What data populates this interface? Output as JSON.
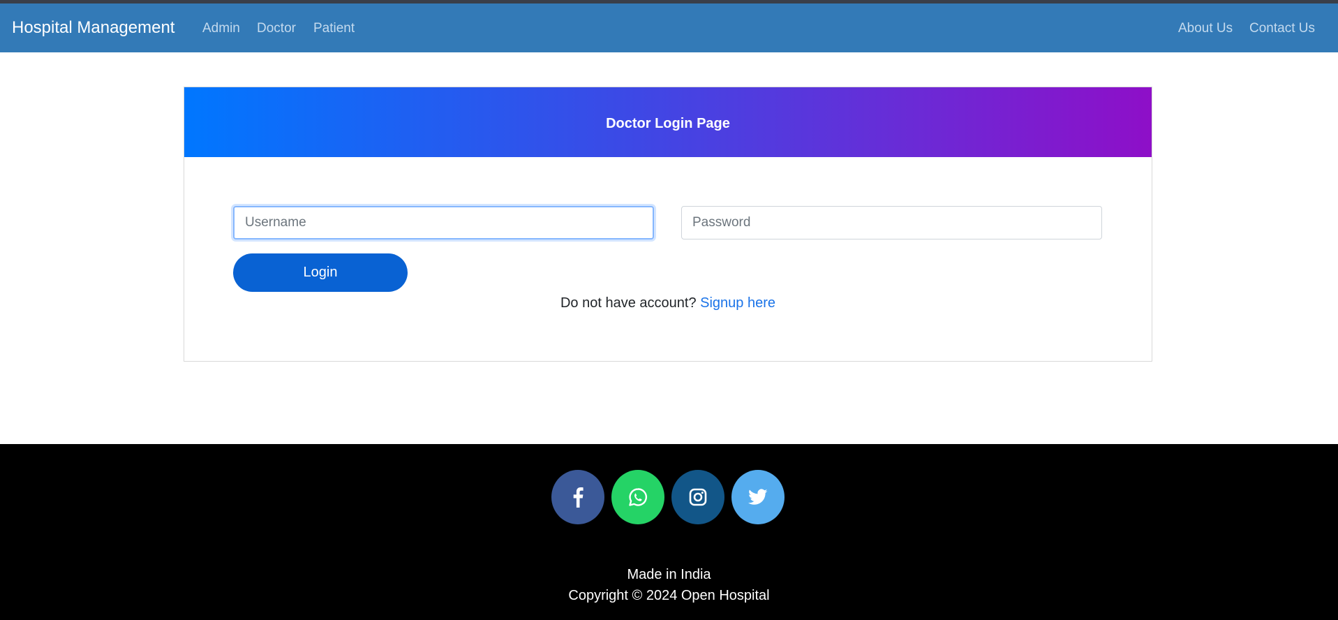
{
  "navbar": {
    "brand": "Hospital Management",
    "links": [
      "Admin",
      "Doctor",
      "Patient"
    ],
    "right_links": [
      "About Us",
      "Contact Us"
    ]
  },
  "card": {
    "title": "Doctor Login Page",
    "username_placeholder": "Username",
    "username_value": "",
    "password_placeholder": "Password",
    "password_value": "",
    "login_label": "Login",
    "signup_prompt": "Do not have account?",
    "signup_link": "Signup here"
  },
  "footer": {
    "social": [
      {
        "name": "facebook-icon",
        "color": "#3b5998"
      },
      {
        "name": "whatsapp-icon",
        "color": "#25d366"
      },
      {
        "name": "instagram-icon",
        "color": "#125688"
      },
      {
        "name": "twitter-icon",
        "color": "#55acee"
      }
    ],
    "made_in": "Made in India",
    "copyright": "Copyright © 2024 Open Hospital"
  },
  "colors": {
    "navbar": "#337ab7",
    "login_button": "#0962d3",
    "link": "#1a73e8",
    "footer_bg": "#000000"
  }
}
